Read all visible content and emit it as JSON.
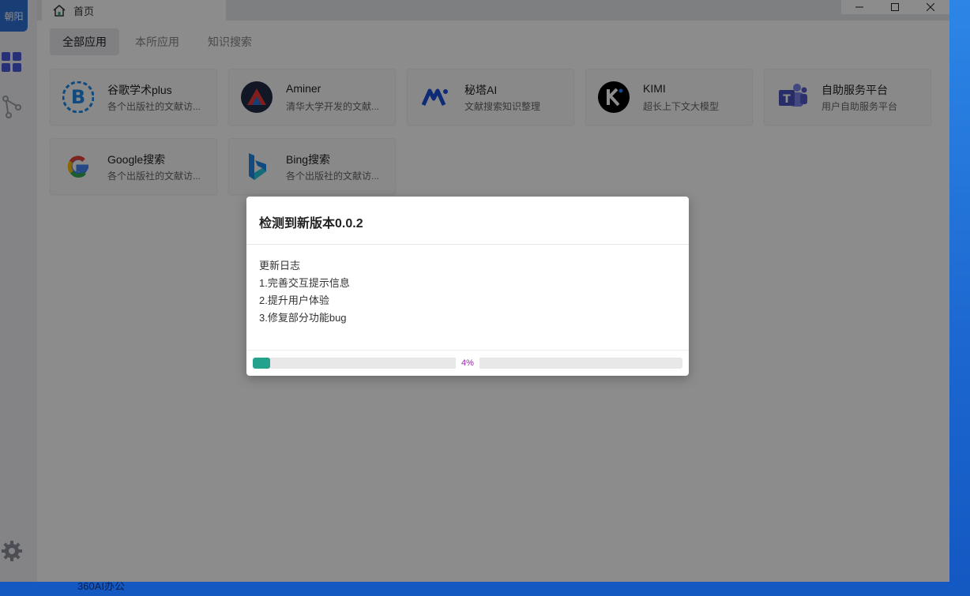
{
  "sidebar": {
    "avatar_label": "朝阳",
    "icons": [
      "apps-grid-icon",
      "knowledge-graph-icon",
      "settings-gear-icon"
    ]
  },
  "titlebar": {
    "home_tab_label": "首页",
    "controls": [
      "minimize",
      "maximize",
      "close"
    ]
  },
  "category_tabs": [
    {
      "label": "全部应用",
      "active": true
    },
    {
      "label": "本所应用",
      "active": false
    },
    {
      "label": "知识搜索",
      "active": false
    }
  ],
  "apps": [
    {
      "name": "谷歌学术plus",
      "desc": "各个出版社的文献访...",
      "icon": "google-scholar-b-icon"
    },
    {
      "name": "Aminer",
      "desc": "清华大学开发的文献...",
      "icon": "aminer-icon"
    },
    {
      "name": "秘塔AI",
      "desc": "文献搜索知识整理",
      "icon": "metaso-icon"
    },
    {
      "name": "KIMI",
      "desc": "超长上下文大模型",
      "icon": "kimi-icon"
    },
    {
      "name": "自助服务平台",
      "desc": "用户自助服务平台",
      "icon": "teams-icon"
    },
    {
      "name": "Google搜索",
      "desc": "各个出版社的文献访...",
      "icon": "google-g-icon"
    },
    {
      "name": "Bing搜索",
      "desc": "各个出版社的文献访...",
      "icon": "bing-icon"
    }
  ],
  "dialog": {
    "title": "检测到新版本0.0.2",
    "changelog_heading": "更新日志",
    "changelog": [
      "1.完善交互提示信息",
      "2.提升用户体验",
      "3.修复部分功能bug"
    ],
    "progress_percent": 4,
    "progress_label": "4%"
  },
  "taskbar": {
    "label": "360AI办公"
  },
  "colors": {
    "accent": "#2f6fd6",
    "progress": "#25a28e",
    "progress_text": "#9c27b0"
  }
}
